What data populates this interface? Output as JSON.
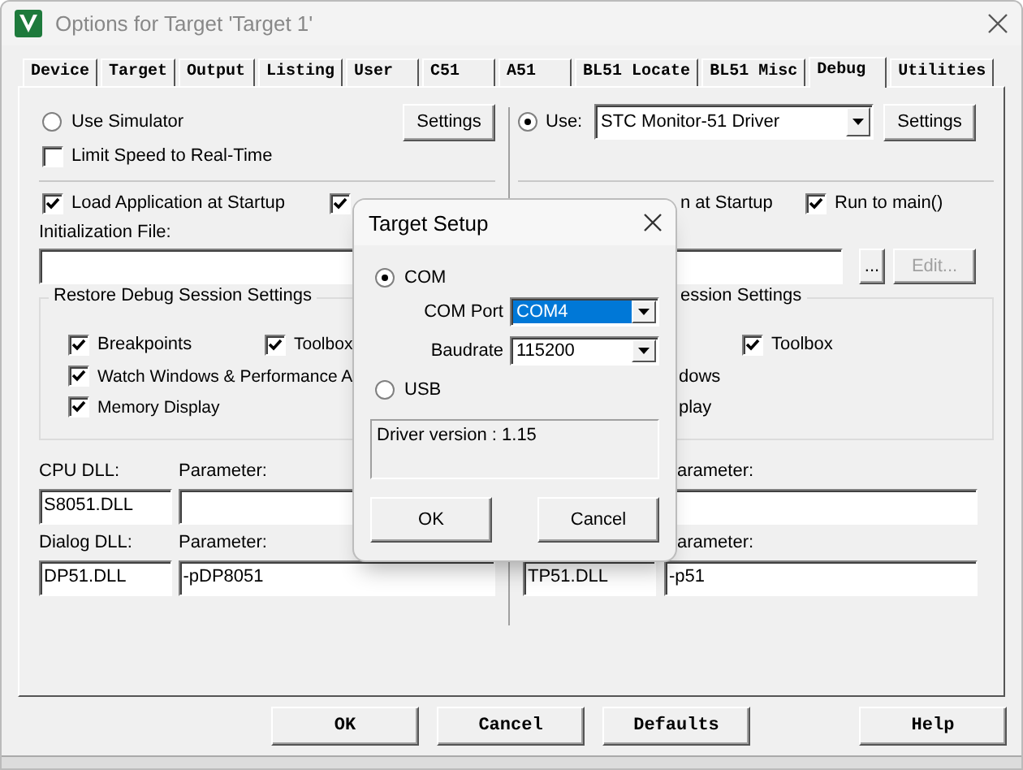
{
  "window": {
    "title": "Options for Target 'Target 1'"
  },
  "tabs": [
    {
      "label": "Device",
      "selected": false
    },
    {
      "label": "Target",
      "selected": false
    },
    {
      "label": "Output",
      "selected": false
    },
    {
      "label": "Listing",
      "selected": false
    },
    {
      "label": "User",
      "selected": false
    },
    {
      "label": "C51",
      "selected": false
    },
    {
      "label": "A51",
      "selected": false
    },
    {
      "label": "BL51 Locate",
      "selected": false
    },
    {
      "label": "BL51 Misc",
      "selected": false
    },
    {
      "label": "Debug",
      "selected": true
    },
    {
      "label": "Utilities",
      "selected": false
    }
  ],
  "left": {
    "simulator": {
      "label": "Use Simulator",
      "selected": false
    },
    "settings_button": "Settings",
    "limit_speed": {
      "label": "Limit Speed to Real-Time",
      "checked": false
    },
    "load_app": {
      "label": "Load Application at Startup",
      "checked": true
    },
    "run_to_main": {
      "checked": true
    },
    "init_file_label": "Initialization File:",
    "restore_group": {
      "title": "Restore Debug Session Settings",
      "options": [
        {
          "label": "Breakpoints",
          "checked": true
        },
        {
          "label": "Toolbox",
          "checked": true
        },
        {
          "label": "Watch Windows & Performance A",
          "checked": true
        },
        {
          "label": "Memory Display",
          "checked": true
        }
      ]
    },
    "cpu_dll": {
      "label": "CPU DLL:",
      "value": "S8051.DLL"
    },
    "cpu_param": {
      "label": "Parameter:"
    },
    "dialog_dll": {
      "label": "Dialog DLL:",
      "value": "DP51.DLL"
    },
    "dialog_param": {
      "label": "Parameter:",
      "value": "-pDP8051"
    }
  },
  "right": {
    "use": {
      "label": "Use:",
      "selected": true
    },
    "driver": "STC Monitor-51 Driver",
    "settings_button": "Settings",
    "load_app_fragment": "n at Startup",
    "run_to_main": {
      "label": "Run to main()",
      "checked": true
    },
    "browse_button": "...",
    "edit_button": {
      "label": "Edit...",
      "disabled": true
    },
    "restore_group": {
      "title": "ession Settings",
      "toolbox": {
        "label": "Toolbox",
        "checked": true
      },
      "fragments": [
        "dows",
        "play"
      ]
    },
    "cpu_param_label": "arameter:",
    "dialog_dll_value": "TP51.DLL",
    "dialog_param": {
      "label": "arameter:",
      "value": "-p51"
    }
  },
  "buttons": [
    "OK",
    "Cancel",
    "Defaults",
    "Help"
  ],
  "modal": {
    "title": "Target Setup",
    "com": {
      "label": "COM",
      "selected": true
    },
    "com_port": {
      "label": "COM Port",
      "value": "COM4"
    },
    "baudrate": {
      "label": "Baudrate",
      "value": "115200"
    },
    "usb": {
      "label": "USB",
      "selected": false
    },
    "driver_version": "Driver version : 1.15",
    "buttons": [
      "OK",
      "Cancel"
    ]
  }
}
